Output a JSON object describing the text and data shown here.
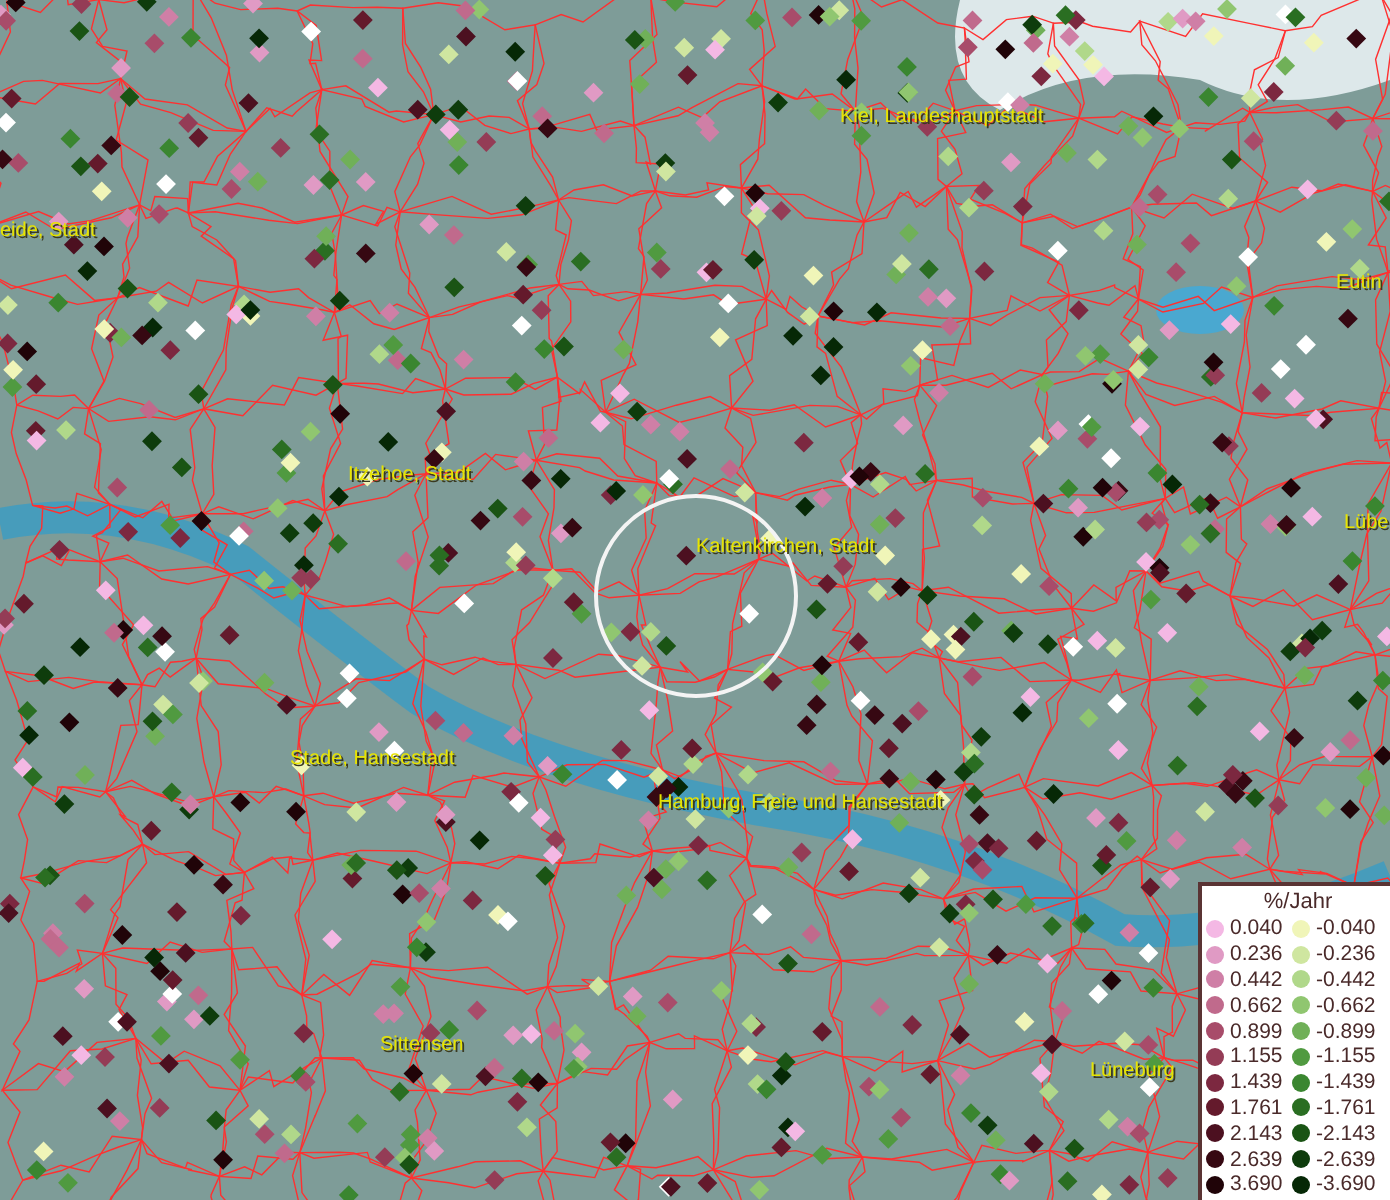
{
  "map": {
    "places": [
      {
        "name": "eide, Stadt"
      },
      {
        "name": "Kiel, Landeshauptstadt"
      },
      {
        "name": "Eutin"
      },
      {
        "name": "Itzehoe, Stadt"
      },
      {
        "name": "Kaltenkirchen, Stadt"
      },
      {
        "name": "Lübe"
      },
      {
        "name": "Stade, Hansestadt"
      },
      {
        "name": "Hamburg, Freie und Hansestadt"
      },
      {
        "name": "Sittensen"
      },
      {
        "name": "Lüneburg"
      }
    ]
  },
  "legend": {
    "title": "%/Jahr",
    "positive": [
      {
        "label": "0.040",
        "color": "#f4b8e4"
      },
      {
        "label": "0.236",
        "color": "#e09ac4"
      },
      {
        "label": "0.442",
        "color": "#cf7fa6"
      },
      {
        "label": "0.662",
        "color": "#c06a8c"
      },
      {
        "label": "0.899",
        "color": "#a84c6a"
      },
      {
        "label": "1.155",
        "color": "#943c56"
      },
      {
        "label": "1.439",
        "color": "#7c2840"
      },
      {
        "label": "1.761",
        "color": "#641a2c"
      },
      {
        "label": "2.143",
        "color": "#4c1020"
      },
      {
        "label": "2.639",
        "color": "#360812"
      },
      {
        "label": "3.690",
        "color": "#200408"
      }
    ],
    "negative": [
      {
        "label": "-0.040",
        "color": "#f0f5b8"
      },
      {
        "label": "-0.236",
        "color": "#cfe6a0"
      },
      {
        "label": "-0.442",
        "color": "#b0d88a"
      },
      {
        "label": "-0.662",
        "color": "#90c670"
      },
      {
        "label": "-0.899",
        "color": "#70b058"
      },
      {
        "label": "-1.155",
        "color": "#509a40"
      },
      {
        "label": "-1.439",
        "color": "#3a8630"
      },
      {
        "label": "-1.761",
        "color": "#2a6e22"
      },
      {
        "label": "-2.143",
        "color": "#1a5414"
      },
      {
        "label": "-2.639",
        "color": "#0e3c0c"
      },
      {
        "label": "-3.690",
        "color": "#062806"
      }
    ]
  }
}
